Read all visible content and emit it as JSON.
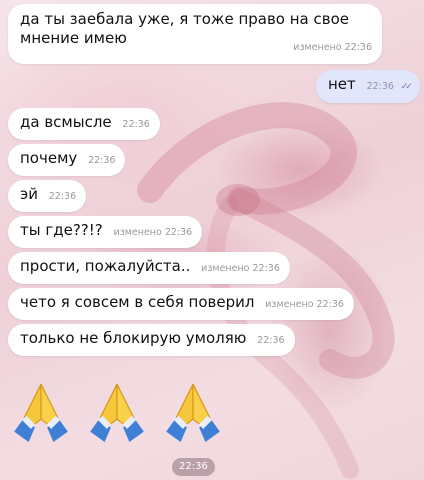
{
  "messages": [
    {
      "text": "да ты заебала уже, я тоже право на свое мнение имею",
      "meta": "изменено 22:36"
    },
    {
      "text": "нет",
      "meta": "22:36"
    },
    {
      "text": "да всмысле",
      "meta": "22:36"
    },
    {
      "text": "почему",
      "meta": "22:36"
    },
    {
      "text": "эй",
      "meta": "22:36"
    },
    {
      "text": "ты где??!?",
      "meta": "изменено 22:36"
    },
    {
      "text": "прости, пожалуйста..",
      "meta": "изменено 22:36"
    },
    {
      "text": "чето я совсем в себя поверил",
      "meta": "изменено 22:36"
    },
    {
      "text": "только не блокирую умоляю",
      "meta": "22:36"
    }
  ],
  "outgoing_read_icon": "double-check-icon",
  "emoji_message": {
    "icon": "folded-hands-icon",
    "count": 3,
    "time": "22:36"
  },
  "colors": {
    "incoming": "#ffffff",
    "outgoing": "#e2e6fb",
    "emoji_skin": "#f6c63b",
    "emoji_sleeve": "#3f7fd6"
  }
}
